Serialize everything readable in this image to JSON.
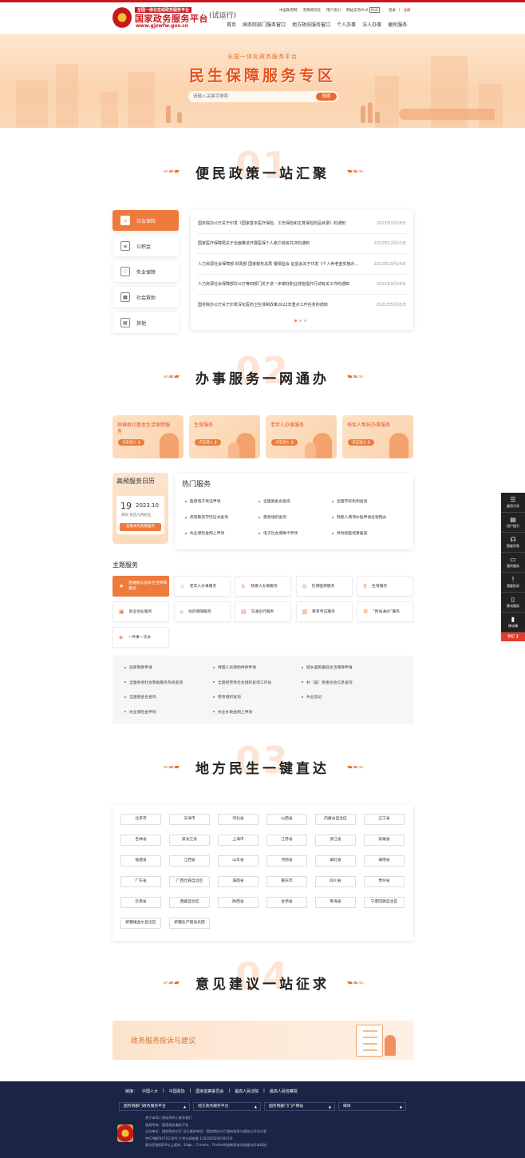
{
  "header": {
    "brand_sub": "全国一体化在线政务服务平台",
    "brand": "国家政务服务平台",
    "url": "www.gjzwfw.gov.cn",
    "trial": "(试运行)",
    "top_links": [
      "中国政府网",
      "无障碍浏览",
      "用户指引",
      "网站支持IPv6",
      "IPv6"
    ],
    "login": "登录",
    "register": "注册",
    "nav": [
      "首页",
      "国务院部门服务窗口",
      "地方政府服务窗口",
      "个人办事",
      "法人办事",
      "便民服务"
    ]
  },
  "hero": {
    "sub": "全国一体化政务服务平台",
    "title": "民生保障服务专区",
    "search_placeholder": "请输入关键字搜索",
    "search_button": "搜索"
  },
  "sections": [
    {
      "num": "01",
      "title": "便民政策一站汇聚"
    },
    {
      "num": "02",
      "title": "办事服务一网通办"
    },
    {
      "num": "03",
      "title": "地方民生一键直达"
    },
    {
      "num": "04",
      "title": "意见建议一站征求"
    }
  ],
  "policy": {
    "categories": [
      {
        "label": "社会保险",
        "icon": "shield-icon"
      },
      {
        "label": "公积金",
        "icon": "coins-icon"
      },
      {
        "label": "失业保障",
        "icon": "heart-icon"
      },
      {
        "label": "社会救助",
        "icon": "grid-icon"
      },
      {
        "label": "其他",
        "icon": "calendar-icon"
      }
    ],
    "news": [
      {
        "title": "国务院办公厅关于印发《国家基本医疗保险、工伤保险和生育保险药品目录》的通知",
        "date": "2023年1月18日"
      },
      {
        "title": "国家医疗保障局关于全面推进开展医保个人账户跨省共济的通知",
        "date": "2022年12月21日"
      },
      {
        "title": "人力资源社会保障部 财政部 国家税务总局 银保监会 证监会关于印发《个人养老金实施办法》的通知",
        "date": "2022年10月26日"
      },
      {
        "title": "人力资源社会保障部办公厅等四部门关于进一步做好职业技能提升行动有关工作的通知",
        "date": "2022年9月26日"
      },
      {
        "title": "国务院办公厅关于印发深化医药卫生体制改革2022年重点工作任务的通知",
        "date": "2022年5月25日"
      }
    ]
  },
  "services": {
    "cards": [
      {
        "title": "困难群众基本生活保障服务",
        "btn": "点击进入 ❯"
      },
      {
        "title": "生育服务",
        "btn": "点击进入 ❯"
      },
      {
        "title": "老年人办事服务",
        "btn": "点击进入 ❯"
      },
      {
        "title": "残疾人帮扶办事服务",
        "btn": "点击进入 ❯"
      }
    ],
    "calendar": {
      "heading": "高频服务日历",
      "day": "19",
      "ym": "2023.10",
      "weekday": "周日  农历九月初五",
      "btn": "查看本月高频服务"
    },
    "hot": {
      "heading": "热门服务",
      "items": [
        "医保电子凭证申领",
        "全国基金会查询",
        "全国学校机构查询",
        "高等教育学历证书查询",
        "慈善组织查询",
        "残疾人两项补贴申请全程网办",
        "失业保险金网上申领",
        "电子社会保障卡申领",
        "异地就医结算备案"
      ]
    }
  },
  "themes": {
    "heading": "主题服务",
    "items": [
      {
        "label": "困难群众基本生活保障服务",
        "icon": "★"
      },
      {
        "label": "老年人办事服务",
        "icon": "♨"
      },
      {
        "label": "残疾人办事服务",
        "icon": "♿"
      },
      {
        "label": "社保医保服务",
        "icon": "◎"
      },
      {
        "label": "生育服务",
        "icon": "♀"
      },
      {
        "label": "就业创业服务",
        "icon": "▣"
      },
      {
        "label": "住房保障服务",
        "icon": "⌂"
      },
      {
        "label": "交通出行服务",
        "icon": "▤"
      },
      {
        "label": "教育考试服务",
        "icon": "▥"
      },
      {
        "label": "“跨省通办”服务",
        "icon": "⚙"
      },
      {
        "label": "一件事一次办",
        "icon": "◈"
      }
    ],
    "links": [
      "低保救助申请",
      "特困人员救助供养申请",
      "城乡居民最低生活保障申请",
      "全国各地社会救助服务热线查询",
      "全国经营性社会组织查询工作站",
      "村（居）民委员会信息查询",
      "全国基金会查询",
      "慈善组织查询",
      "失业登记",
      "失业保险金申领",
      "失业补助金网上申领"
    ]
  },
  "provinces": [
    "北京市",
    "天津市",
    "河北省",
    "山西省",
    "内蒙古自治区",
    "辽宁省",
    "吉林省",
    "黑龙江省",
    "上海市",
    "江苏省",
    "浙江省",
    "安徽省",
    "福建省",
    "江西省",
    "山东省",
    "河南省",
    "湖北省",
    "湖南省",
    "广东省",
    "广西壮族自治区",
    "海南省",
    "重庆市",
    "四川省",
    "贵州省",
    "云南省",
    "西藏自治区",
    "陕西省",
    "甘肃省",
    "青海省",
    "宁夏回族自治区",
    "新疆维吾尔自治区",
    "新疆生产建设兵团"
  ],
  "complaint": {
    "title": "政务服务投诉与建议"
  },
  "sidebar": {
    "items": [
      {
        "label": "使用引导",
        "icon": "guide-icon",
        "glyph": "☰"
      },
      {
        "label": "用户指引",
        "icon": "manual-icon",
        "glyph": "▤"
      },
      {
        "label": "智能问答",
        "icon": "headset-icon",
        "glyph": "☊"
      },
      {
        "label": "我的服务",
        "icon": "monitor-icon",
        "glyph": "▭"
      },
      {
        "label": "我要投诉",
        "icon": "complaint-icon",
        "glyph": "!"
      },
      {
        "label": "移动服务",
        "icon": "mobile-icon",
        "glyph": "▯"
      },
      {
        "label": "移动端",
        "icon": "phone-icon",
        "glyph": "▮"
      }
    ],
    "close": "收起 ❯"
  },
  "footer": {
    "links_label": "链接：",
    "links": [
      "中国人大",
      "中国政协",
      "国家监察委员会",
      "最高人民法院",
      "最高人民检察院"
    ],
    "selects": [
      "国务院部门政务服务平台",
      "地方政务服务平台",
      "国务院部门门户网站",
      "媒体"
    ],
    "info": [
      "关于本网  |  网站声明  |  联系我们",
      "版权所有：国家政务服务平台",
      "主办单位：国务院办公厅    运行维护单位：国务院办公厅政府信息与政务公开办公室",
      "京ICP备05070218号-3    京公网安备 11010202001001号",
      "建议您使用IE9以上版本、Edge、Chrome、Firefox的较新版本浏览器访问本网站"
    ]
  },
  "colors": {
    "brand_red": "#c8171e",
    "accent_orange": "#ee7b3d",
    "footer_bg": "#1a2444"
  }
}
